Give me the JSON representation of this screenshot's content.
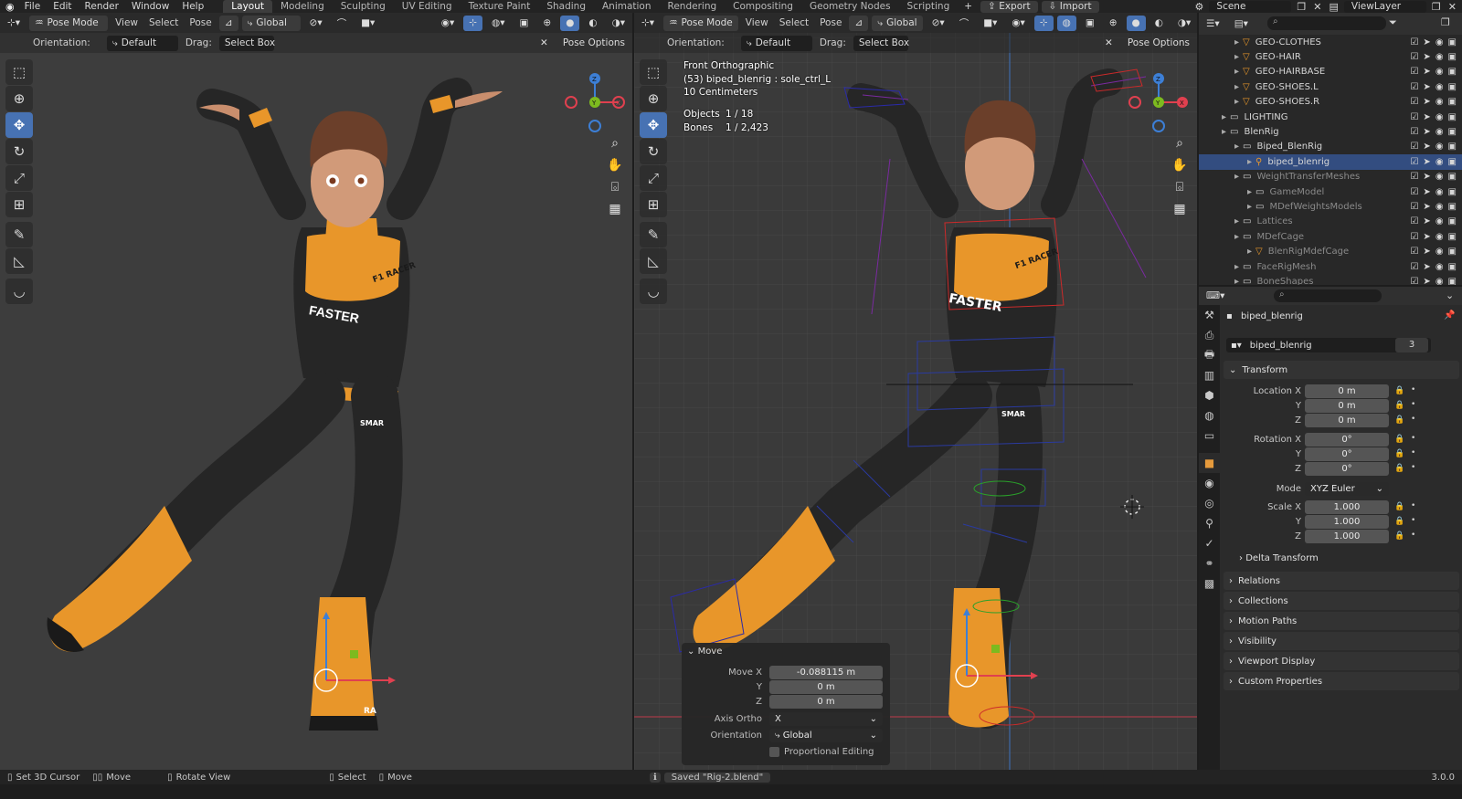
{
  "topbar": {
    "menus": [
      "File",
      "Edit",
      "Render",
      "Window",
      "Help"
    ],
    "workspaces": [
      "Layout",
      "Modeling",
      "Sculpting",
      "UV Editing",
      "Texture Paint",
      "Shading",
      "Animation",
      "Rendering",
      "Compositing",
      "Geometry Nodes",
      "Scripting"
    ],
    "active_workspace": "Layout",
    "export_label": "Export",
    "import_label": "Import",
    "scene_label": "Scene",
    "viewlayer_label": "ViewLayer"
  },
  "viewport_left": {
    "mode": "Pose Mode",
    "menus": [
      "View",
      "Select",
      "Pose"
    ],
    "transform_orientation": "Global",
    "orientation_label": "Orientation:",
    "orientation_value": "Default",
    "drag_label": "Drag:",
    "drag_value": "Select Box",
    "pose_options": "Pose Options"
  },
  "viewport_right": {
    "mode": "Pose Mode",
    "menus": [
      "View",
      "Select",
      "Pose"
    ],
    "transform_orientation": "Global",
    "orientation_label": "Orientation:",
    "orientation_value": "Default",
    "drag_label": "Drag:",
    "drag_value": "Select Box",
    "pose_options": "Pose Options",
    "overlay": {
      "view_name": "Front Orthographic",
      "active": "(53) biped_blenrig : sole_ctrl_L",
      "grid_scale": "10 Centimeters",
      "objects_label": "Objects",
      "objects_value": "1 / 18",
      "bones_label": "Bones",
      "bones_value": "1 / 2,423"
    }
  },
  "character": {
    "chest_logo": "F1 RACER",
    "chest_text": "FASTER",
    "hip_logo": "SMAR",
    "boot_logo": "RA"
  },
  "gizmo": {
    "x": "X",
    "y": "Y",
    "z": "Z"
  },
  "colors": {
    "accent_blue": "#4772b3",
    "orange": "#e8962a",
    "selection": "#334d80",
    "axis_x": "#e0404f",
    "axis_y": "#7dba1f",
    "axis_z": "#3d7fd6"
  },
  "outliner": {
    "rows": [
      {
        "label": "GEO-CLOTHES",
        "indent": 2,
        "icon": "triangle",
        "dim": false
      },
      {
        "label": "GEO-HAIR",
        "indent": 2,
        "icon": "triangle",
        "dim": false
      },
      {
        "label": "GEO-HAIRBASE",
        "indent": 2,
        "icon": "triangle",
        "dim": false
      },
      {
        "label": "GEO-SHOES.L",
        "indent": 2,
        "icon": "triangle",
        "dim": false
      },
      {
        "label": "GEO-SHOES.R",
        "indent": 2,
        "icon": "triangle",
        "dim": false
      },
      {
        "label": "LIGHTING",
        "indent": 1,
        "icon": "collection",
        "dim": false
      },
      {
        "label": "BlenRig",
        "indent": 1,
        "icon": "collection",
        "dim": false
      },
      {
        "label": "Biped_BlenRig",
        "indent": 2,
        "icon": "collection",
        "dim": false
      },
      {
        "label": "biped_blenrig",
        "indent": 3,
        "icon": "armature",
        "dim": false,
        "selected": true
      },
      {
        "label": "WeightTransferMeshes",
        "indent": 2,
        "icon": "collection",
        "dim": true
      },
      {
        "label": "GameModel",
        "indent": 3,
        "icon": "collection",
        "dim": true
      },
      {
        "label": "MDefWeightsModels",
        "indent": 3,
        "icon": "collection",
        "dim": true
      },
      {
        "label": "Lattices",
        "indent": 2,
        "icon": "collection",
        "dim": true
      },
      {
        "label": "MDefCage",
        "indent": 2,
        "icon": "collection",
        "dim": true
      },
      {
        "label": "BlenRigMdefCage",
        "indent": 3,
        "icon": "triangle",
        "dim": true
      },
      {
        "label": "FaceRigMesh",
        "indent": 2,
        "icon": "collection",
        "dim": true
      },
      {
        "label": "BoneShapes",
        "indent": 2,
        "icon": "collection",
        "dim": true
      }
    ]
  },
  "properties": {
    "object_name": "biped_blenrig",
    "data_name": "biped_blenrig",
    "users": "3",
    "transform_title": "Transform",
    "location_x_label": "Location X",
    "y_label": "Y",
    "z_label": "Z",
    "location": [
      "0 m",
      "0 m",
      "0 m"
    ],
    "rotation_x_label": "Rotation X",
    "rotation": [
      "0°",
      "0°",
      "0°"
    ],
    "mode_label": "Mode",
    "mode_value": "XYZ Euler",
    "scale_x_label": "Scale X",
    "scale": [
      "1.000",
      "1.000",
      "1.000"
    ],
    "delta_transform": "Delta Transform",
    "panels": [
      "Relations",
      "Collections",
      "Motion Paths",
      "Visibility",
      "Viewport Display",
      "Custom Properties"
    ]
  },
  "move_panel": {
    "title": "Move",
    "move_x_label": "Move X",
    "y_label": "Y",
    "z_label": "Z",
    "values": [
      "-0.088115 m",
      "0 m",
      "0 m"
    ],
    "axis_ortho_label": "Axis Ortho",
    "axis_ortho_value": "X",
    "orientation_label": "Orientation",
    "orientation_value": "Global",
    "proportional_label": "Proportional Editing"
  },
  "status": {
    "set_cursor": "Set 3D Cursor",
    "move": "Move",
    "rotate_view": "Rotate View",
    "select": "Select",
    "move2": "Move",
    "saved": "Saved \"Rig-2.blend\"",
    "version": "3.0.0"
  }
}
